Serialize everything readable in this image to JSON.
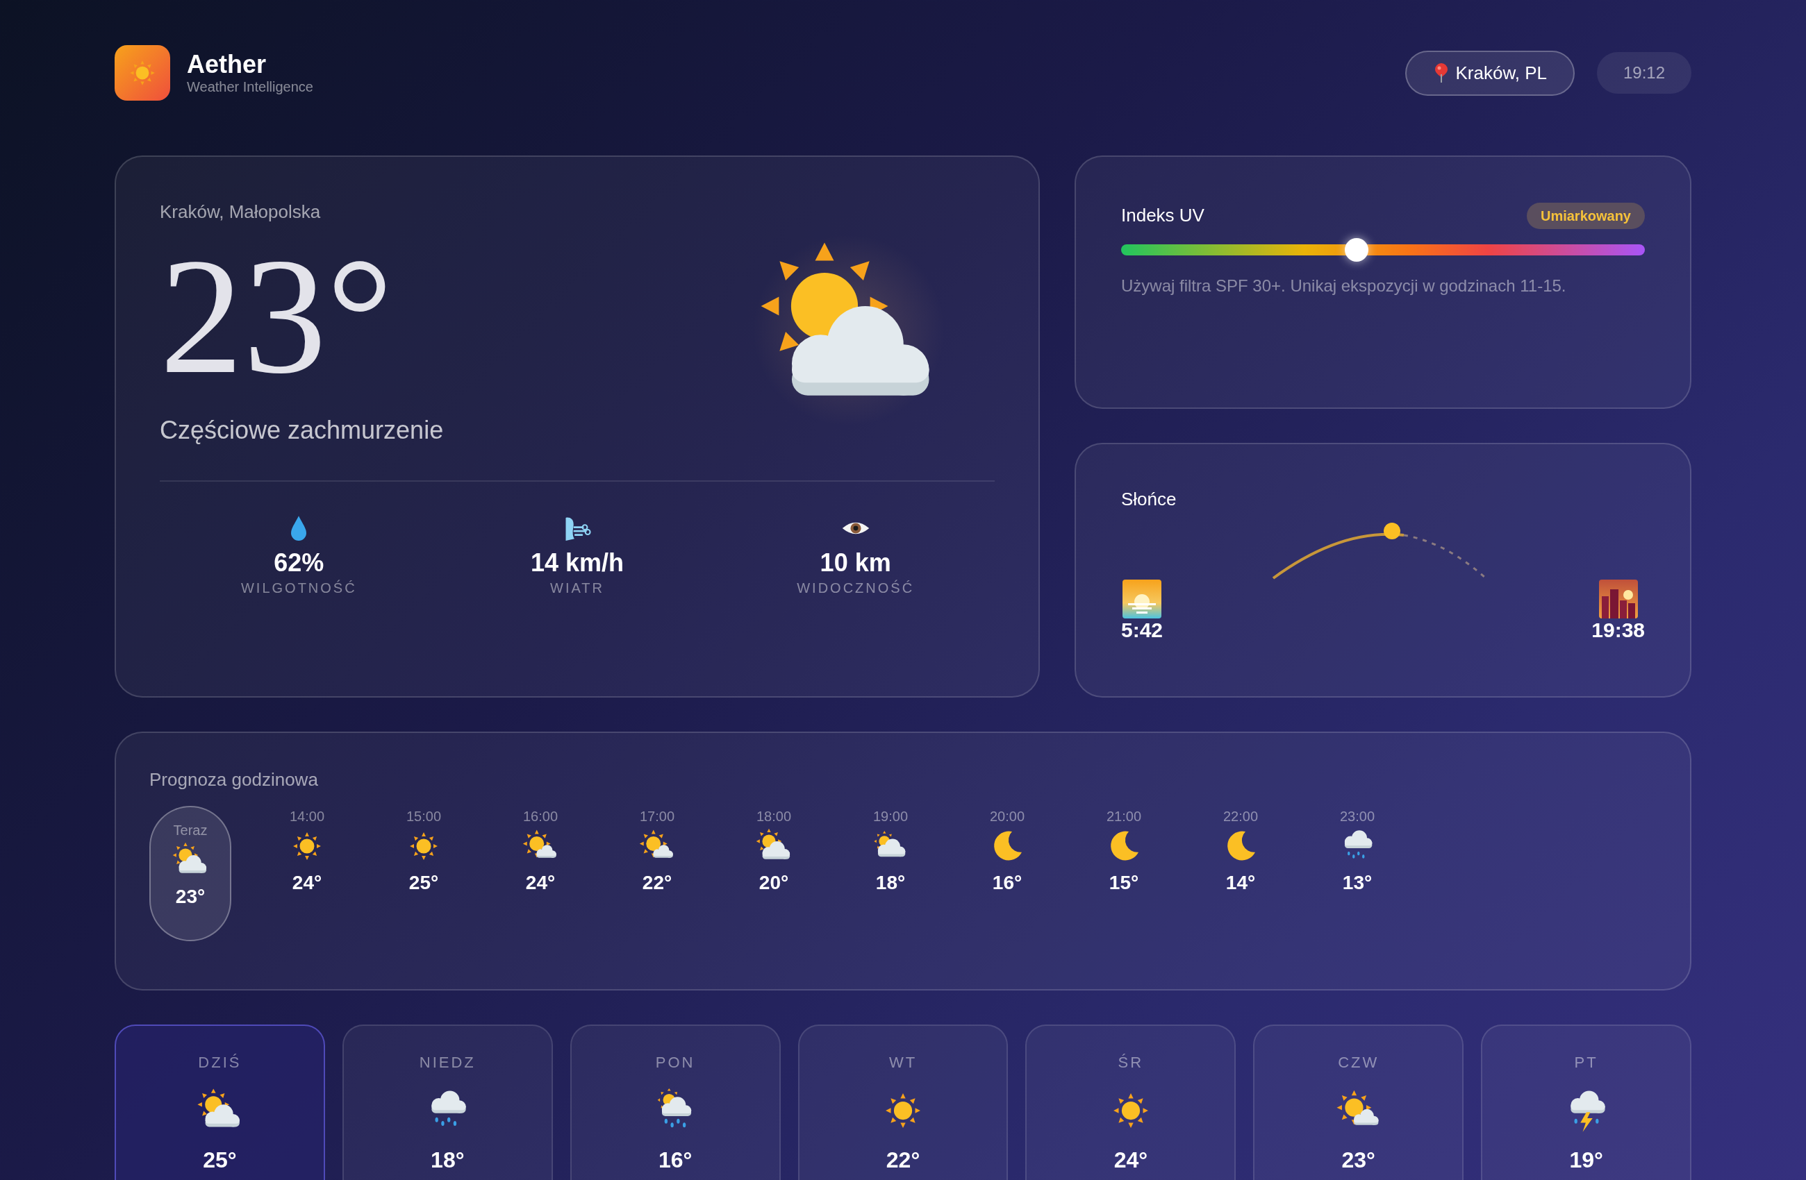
{
  "header": {
    "app_name": "Aether",
    "tagline": "Weather Intelligence",
    "location": "Kraków, PL",
    "time": "19:12"
  },
  "current": {
    "location": "Kraków, Małopolska",
    "temperature": "23°",
    "condition": "Częściowe zachmurzenie",
    "kind": "partly",
    "stats": [
      {
        "kind": "humidity",
        "value": "62%",
        "label": "WILGOTNOŚĆ"
      },
      {
        "kind": "wind",
        "value": "14 km/h",
        "label": "WIATR"
      },
      {
        "kind": "visibility",
        "value": "10 km",
        "label": "WIDOCZNOŚĆ"
      }
    ]
  },
  "uv": {
    "title": "Indeks UV",
    "badge": "Umiarkowany",
    "level": 0.45,
    "advice": "Używaj filtra SPF 30+. Unikaj ekspozycji w godzinach 11-15."
  },
  "sun": {
    "title": "Słońce",
    "sunrise": "5:42",
    "sunset": "19:38"
  },
  "hourly": {
    "title": "Prognoza godzinowa",
    "items": [
      {
        "time": "Teraz",
        "kind": "partly",
        "temp": "23°",
        "selected": true
      },
      {
        "time": "14:00",
        "kind": "sun",
        "temp": "24°",
        "selected": false
      },
      {
        "time": "15:00",
        "kind": "sun",
        "temp": "25°",
        "selected": false
      },
      {
        "time": "16:00",
        "kind": "mostly-sunny",
        "temp": "24°",
        "selected": false
      },
      {
        "time": "17:00",
        "kind": "mostly-sunny",
        "temp": "22°",
        "selected": false
      },
      {
        "time": "18:00",
        "kind": "partly",
        "temp": "20°",
        "selected": false
      },
      {
        "time": "19:00",
        "kind": "mostly-cloudy",
        "temp": "18°",
        "selected": false
      },
      {
        "time": "20:00",
        "kind": "moon",
        "temp": "16°",
        "selected": false
      },
      {
        "time": "21:00",
        "kind": "moon",
        "temp": "15°",
        "selected": false
      },
      {
        "time": "22:00",
        "kind": "moon",
        "temp": "14°",
        "selected": false
      },
      {
        "time": "23:00",
        "kind": "rain",
        "temp": "13°",
        "selected": false
      }
    ]
  },
  "daily": [
    {
      "day": "DZIŚ",
      "kind": "partly",
      "temp": "25°",
      "selected": true
    },
    {
      "day": "NIEDZ",
      "kind": "rain",
      "temp": "18°",
      "selected": false
    },
    {
      "day": "PON",
      "kind": "sun-rain",
      "temp": "16°",
      "selected": false
    },
    {
      "day": "WT",
      "kind": "sun",
      "temp": "22°",
      "selected": false
    },
    {
      "day": "ŚR",
      "kind": "sun",
      "temp": "24°",
      "selected": false
    },
    {
      "day": "CZW",
      "kind": "mostly-sunny",
      "temp": "23°",
      "selected": false
    },
    {
      "day": "PT",
      "kind": "storm",
      "temp": "19°",
      "selected": false
    }
  ]
}
